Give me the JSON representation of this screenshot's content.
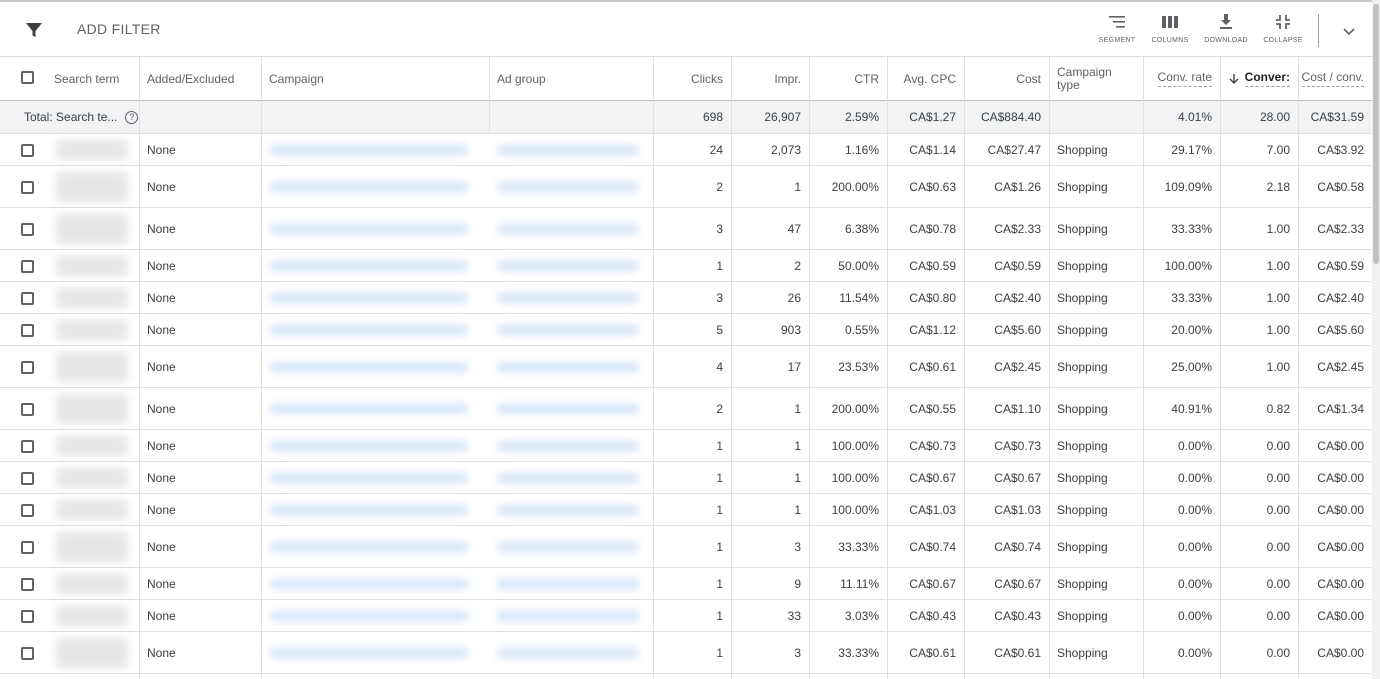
{
  "toolbar": {
    "add_filter_label": "ADD FILTER",
    "segment_label": "SEGMENT",
    "columns_label": "COLUMNS",
    "download_label": "DOWNLOAD",
    "collapse_label": "COLLAPSE"
  },
  "columns": {
    "search_term": "Search term",
    "added_excluded": "Added/Excluded",
    "campaign": "Campaign",
    "ad_group": "Ad group",
    "clicks": "Clicks",
    "impr": "Impr.",
    "ctr": "CTR",
    "avg_cpc": "Avg. CPC",
    "cost": "Cost",
    "campaign_type_line1": "Campaign",
    "campaign_type_line2": "type",
    "conv_rate": "Conv. rate",
    "conversions": "Conver:",
    "cost_per_conv": "Cost / conv."
  },
  "total": {
    "label": "Total: Search te...",
    "help": "?",
    "clicks": "698",
    "impr": "26,907",
    "ctr": "2.59%",
    "avg_cpc": "CA$1.27",
    "cost": "CA$884.40",
    "conv_rate": "4.01%",
    "conversions": "28.00",
    "cost_per_conv": "CA$31.59"
  },
  "rows": [
    {
      "added": "None",
      "clicks": "24",
      "impr": "2,073",
      "ctr": "1.16%",
      "avg_cpc": "CA$1.14",
      "cost": "CA$27.47",
      "type": "Shopping",
      "conv_rate": "29.17%",
      "conv": "7.00",
      "cpc_conv": "CA$3.92"
    },
    {
      "added": "None",
      "clicks": "2",
      "impr": "1",
      "ctr": "200.00%",
      "avg_cpc": "CA$0.63",
      "cost": "CA$1.26",
      "type": "Shopping",
      "conv_rate": "109.09%",
      "conv": "2.18",
      "cpc_conv": "CA$0.58"
    },
    {
      "added": "None",
      "clicks": "3",
      "impr": "47",
      "ctr": "6.38%",
      "avg_cpc": "CA$0.78",
      "cost": "CA$2.33",
      "type": "Shopping",
      "conv_rate": "33.33%",
      "conv": "1.00",
      "cpc_conv": "CA$2.33"
    },
    {
      "added": "None",
      "clicks": "1",
      "impr": "2",
      "ctr": "50.00%",
      "avg_cpc": "CA$0.59",
      "cost": "CA$0.59",
      "type": "Shopping",
      "conv_rate": "100.00%",
      "conv": "1.00",
      "cpc_conv": "CA$0.59"
    },
    {
      "added": "None",
      "clicks": "3",
      "impr": "26",
      "ctr": "11.54%",
      "avg_cpc": "CA$0.80",
      "cost": "CA$2.40",
      "type": "Shopping",
      "conv_rate": "33.33%",
      "conv": "1.00",
      "cpc_conv": "CA$2.40"
    },
    {
      "added": "None",
      "clicks": "5",
      "impr": "903",
      "ctr": "0.55%",
      "avg_cpc": "CA$1.12",
      "cost": "CA$5.60",
      "type": "Shopping",
      "conv_rate": "20.00%",
      "conv": "1.00",
      "cpc_conv": "CA$5.60"
    },
    {
      "added": "None",
      "clicks": "4",
      "impr": "17",
      "ctr": "23.53%",
      "avg_cpc": "CA$0.61",
      "cost": "CA$2.45",
      "type": "Shopping",
      "conv_rate": "25.00%",
      "conv": "1.00",
      "cpc_conv": "CA$2.45"
    },
    {
      "added": "None",
      "clicks": "2",
      "impr": "1",
      "ctr": "200.00%",
      "avg_cpc": "CA$0.55",
      "cost": "CA$1.10",
      "type": "Shopping",
      "conv_rate": "40.91%",
      "conv": "0.82",
      "cpc_conv": "CA$1.34"
    },
    {
      "added": "None",
      "clicks": "1",
      "impr": "1",
      "ctr": "100.00%",
      "avg_cpc": "CA$0.73",
      "cost": "CA$0.73",
      "type": "Shopping",
      "conv_rate": "0.00%",
      "conv": "0.00",
      "cpc_conv": "CA$0.00"
    },
    {
      "added": "None",
      "clicks": "1",
      "impr": "1",
      "ctr": "100.00%",
      "avg_cpc": "CA$0.67",
      "cost": "CA$0.67",
      "type": "Shopping",
      "conv_rate": "0.00%",
      "conv": "0.00",
      "cpc_conv": "CA$0.00"
    },
    {
      "added": "None",
      "clicks": "1",
      "impr": "1",
      "ctr": "100.00%",
      "avg_cpc": "CA$1.03",
      "cost": "CA$1.03",
      "type": "Shopping",
      "conv_rate": "0.00%",
      "conv": "0.00",
      "cpc_conv": "CA$0.00"
    },
    {
      "added": "None",
      "clicks": "1",
      "impr": "3",
      "ctr": "33.33%",
      "avg_cpc": "CA$0.74",
      "cost": "CA$0.74",
      "type": "Shopping",
      "conv_rate": "0.00%",
      "conv": "0.00",
      "cpc_conv": "CA$0.00"
    },
    {
      "added": "None",
      "clicks": "1",
      "impr": "9",
      "ctr": "11.11%",
      "avg_cpc": "CA$0.67",
      "cost": "CA$0.67",
      "type": "Shopping",
      "conv_rate": "0.00%",
      "conv": "0.00",
      "cpc_conv": "CA$0.00"
    },
    {
      "added": "None",
      "clicks": "1",
      "impr": "33",
      "ctr": "3.03%",
      "avg_cpc": "CA$0.43",
      "cost": "CA$0.43",
      "type": "Shopping",
      "conv_rate": "0.00%",
      "conv": "0.00",
      "cpc_conv": "CA$0.00"
    },
    {
      "added": "None",
      "clicks": "1",
      "impr": "3",
      "ctr": "33.33%",
      "avg_cpc": "CA$0.61",
      "cost": "CA$0.61",
      "type": "Shopping",
      "conv_rate": "0.00%",
      "conv": "0.00",
      "cpc_conv": "CA$0.00"
    }
  ]
}
